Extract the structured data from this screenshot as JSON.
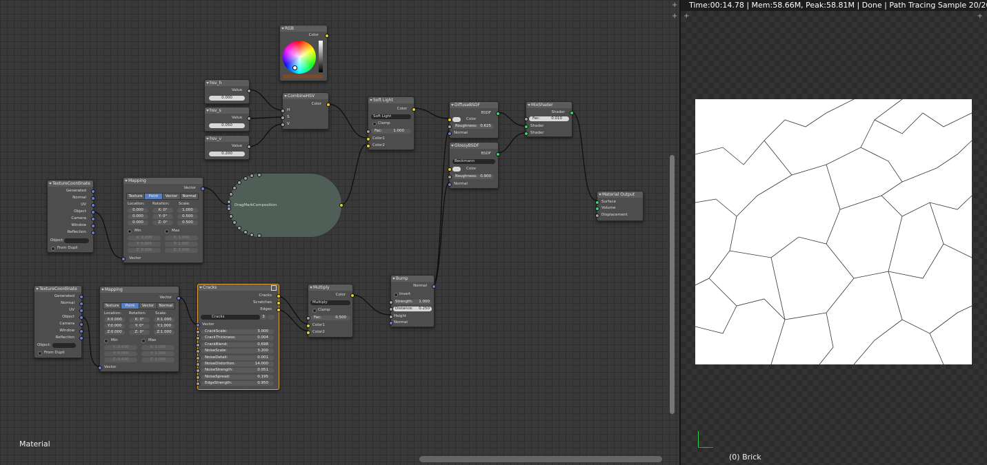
{
  "editor": {
    "label": "Material"
  },
  "render": {
    "status": "Time:00:14.78 | Mem:58.66M, Peak:58.81M | Done | Path Tracing Sample 20/20",
    "object": "(0) Brick"
  },
  "colors": {
    "input_vector": "#6e7fd0",
    "input_color": "#e8d02a",
    "input_float": "#a1a1a1",
    "shader": "#3bd66b",
    "selected": "#e0a23a"
  },
  "nodes": {
    "rgb": {
      "title": "RGB",
      "out": "Color"
    },
    "hsv_h": {
      "title": "hsv_h",
      "out": "Value",
      "val": "0.000"
    },
    "hsv_s": {
      "title": "hsv_s",
      "out": "Value",
      "val": "0.050"
    },
    "hsv_v": {
      "title": "hsv_v",
      "out": "Value",
      "val": "0.200"
    },
    "combine": {
      "title": "CombineHSV",
      "out": "Color",
      "h": "H",
      "s": "S",
      "v": "V"
    },
    "soft": {
      "title": "Soft Light",
      "out": "Color",
      "mode": "Soft Light",
      "clamp": "Clamp",
      "fac": "Fac:",
      "fac_val": "1.000",
      "c1": "Color1",
      "c2": "Color2"
    },
    "diffuse": {
      "title": "DiffuseBSDF",
      "out": "BSDF",
      "color": "Color",
      "rough": "Roughness:",
      "rough_val": "0.625",
      "normal": "Normal"
    },
    "glossy": {
      "title": "GlossyBSDF",
      "out": "BSDF",
      "dist": "Beckmann",
      "color": "Color",
      "rough": "Roughness:",
      "rough_val": "0.900",
      "normal": "Normal"
    },
    "mix": {
      "title": "MixShader",
      "out": "Shader",
      "fac": "Fac:",
      "fac_val": "0.010",
      "s1": "Shader",
      "s2": "Shader"
    },
    "output": {
      "title": "Material Output",
      "surface": "Surface",
      "volume": "Volume",
      "disp": "Displacement"
    },
    "group": {
      "title": "DragMarkComposition"
    },
    "tc1": {
      "title": "TextureCoordinate",
      "outs": [
        "Generated",
        "Normal",
        "UV",
        "Object",
        "Camera",
        "Window",
        "Reflection"
      ],
      "obj": "Object:",
      "fromdupli": "From Dupli"
    },
    "tc2": {
      "title": "TextureCoordinate",
      "outs": [
        "Generated",
        "Normal",
        "UV",
        "Object",
        "Camera",
        "Window",
        "Reflection"
      ],
      "obj": "Object:",
      "fromdupli": "From Dupli"
    },
    "map1": {
      "title": "Mapping",
      "out": "Vector",
      "tabs": [
        "Texture",
        "Point",
        "Vector",
        "Normal"
      ],
      "loc": "Location:",
      "rot": "Rotation:",
      "scale": "Scale:",
      "locv": [
        "0.000",
        "0.000",
        "0.000"
      ],
      "rotv": [
        "X: 0°",
        "Y: 0°",
        "Z: 0°"
      ],
      "scalev": [
        "1.000",
        "0.500",
        "0.500"
      ],
      "min": "Min",
      "max": "Max",
      "minv": [
        "X: 0.000",
        "Y: 0.000",
        "Z: 0.000"
      ],
      "maxv": [
        "X: 1.000",
        "Y: 1.000",
        "Z: 1.000"
      ],
      "in": "Vector"
    },
    "map2": {
      "title": "Mapping",
      "out": "Vector",
      "tabs": [
        "Texture",
        "Point",
        "Vector",
        "Normal"
      ],
      "loc": "Location:",
      "rot": "Rotation:",
      "scale": "Scale:",
      "locv": [
        "X:0.000",
        "Y:0.000",
        "Z:0.000"
      ],
      "rotv": [
        "X: 0°",
        "Y: 0°",
        "Z: 0°"
      ],
      "scalev": [
        "X:1.000",
        "Y:1.000",
        "Z:1.000"
      ],
      "min": "Min",
      "max": "Max",
      "minv": [
        "X: 0.000",
        "Y: 0.000",
        "Z: 0.000"
      ],
      "maxv": [
        "X: 1.000",
        "Y: 1.000",
        "Z: 1.000"
      ],
      "in": "Vector"
    },
    "cracks": {
      "title": "Cracks",
      "outs": [
        "Cracks",
        "Scratches",
        "Edges"
      ],
      "group": "Cracks",
      "num": "3",
      "in": "Vector",
      "params": [
        [
          "CrackScale:",
          "3.000"
        ],
        [
          "CrackThickness:",
          "0.004"
        ],
        [
          "CrackBlend:",
          "0.698"
        ],
        [
          "NoiseScale:",
          "3.200"
        ],
        [
          "NoiseDetail:",
          "0.001"
        ],
        [
          "NoiseDistortion:",
          "14.000"
        ],
        [
          "NoiseStrength:",
          "0.051"
        ],
        [
          "NoiseSpread:",
          "0.195"
        ],
        [
          "EdgeStrength:",
          "0.950"
        ]
      ]
    },
    "multiply": {
      "title": "Multiply",
      "out": "Color",
      "mode": "Multiply",
      "clamp": "Clamp",
      "fac": "Fac:",
      "fac_val": "0.500",
      "c1": "Color1",
      "c2": "Color2"
    },
    "bump": {
      "title": "Bump",
      "out": "Normal",
      "invert": "Invert",
      "strength": "Strength:",
      "strength_val": "1.000",
      "distance": "Distance:",
      "distance_val": "0.250",
      "height": "Height",
      "normal": "Normal"
    }
  }
}
